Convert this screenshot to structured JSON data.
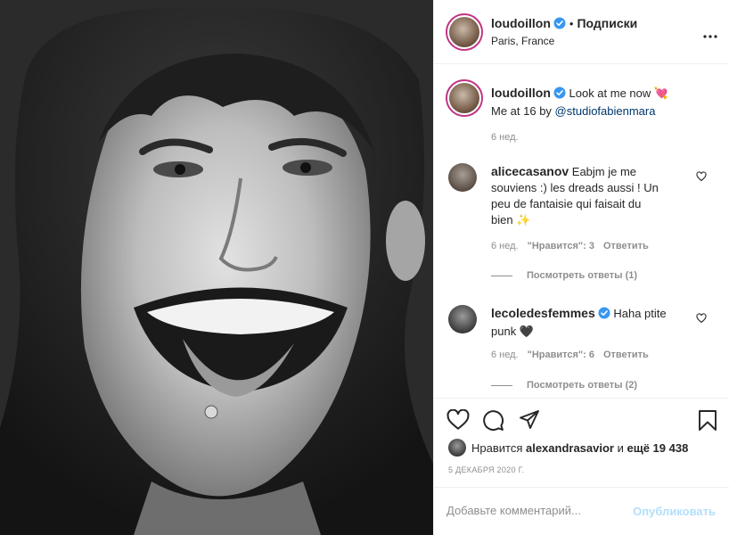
{
  "post": {
    "author": "loudoillon",
    "separator": "•",
    "follow_label": "Подписки",
    "location": "Paris, France",
    "more_label": "•••"
  },
  "caption": {
    "username": "loudoillon",
    "text_line1": "Look at me now 💘",
    "text_line2_prefix": "Me at 16 by ",
    "mention": "@studiofabienmara",
    "age": "6 нед."
  },
  "comments": [
    {
      "username": "alicecasanov",
      "text_line1": " Eabjm je me",
      "text_line2": "souviens :) les dreads aussi ! Un",
      "text_line3": "peu de fantaisie qui faisait du",
      "text_line4": "bien ✨",
      "age": "6 нед.",
      "likes": "\"Нравится\": 3",
      "reply": "Ответить",
      "view_replies": "Посмотреть ответы (1)"
    },
    {
      "username": "lecoledesfemmes",
      "text_line1": " Haha ptite",
      "text_line2": "punk 🖤",
      "age": "6 нед.",
      "likes": "\"Нравится\": 6",
      "reply": "Ответить",
      "view_replies": "Посмотреть ответы (2)"
    }
  ],
  "likes_line": {
    "prefix": "Нравится ",
    "user": "alexandrasavior",
    "middle": " и ",
    "count": "ещё 19 438"
  },
  "date": "5 декабря 2020 г.",
  "add_comment": {
    "placeholder": "Добавьте комментарий...",
    "publish": "Опубликовать"
  },
  "colors": {
    "verified": "#3897f0",
    "link": "#00376b",
    "muted": "#8e8e8e",
    "publish_disabled": "#b2dffc"
  },
  "icons": {
    "like": "heart-icon",
    "comment": "comment-icon",
    "share": "send-icon",
    "save": "bookmark-icon"
  }
}
